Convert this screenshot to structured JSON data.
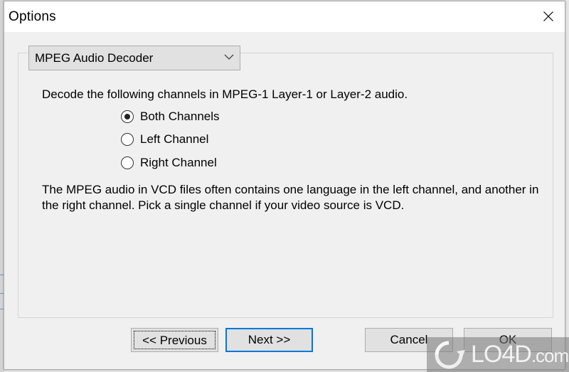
{
  "window": {
    "title": "Options",
    "close_icon": "close-icon"
  },
  "decoder_select": {
    "selected": "MPEG Audio Decoder",
    "icon": "chevron-down-icon"
  },
  "panel": {
    "prompt": "Decode the following channels in MPEG-1 Layer-1 or Layer-2 audio.",
    "options": [
      {
        "label": "Both Channels",
        "checked": true
      },
      {
        "label": "Left Channel",
        "checked": false
      },
      {
        "label": "Right Channel",
        "checked": false
      }
    ],
    "note": "The MPEG audio in VCD files often contains one language in the left channel, and another in the right channel. Pick a single channel if your video source is VCD."
  },
  "buttons": {
    "previous": "<< Previous",
    "next": "Next >>",
    "cancel": "Cancel",
    "ok": "OK"
  },
  "watermark": {
    "brand": "LO4D",
    "suffix": ".com"
  },
  "colors": {
    "focus_blue": "#0078d7",
    "dialog_bg": "#f0f0f0",
    "titlebar_bg": "#ffffff",
    "button_bg": "#e1e1e1"
  }
}
